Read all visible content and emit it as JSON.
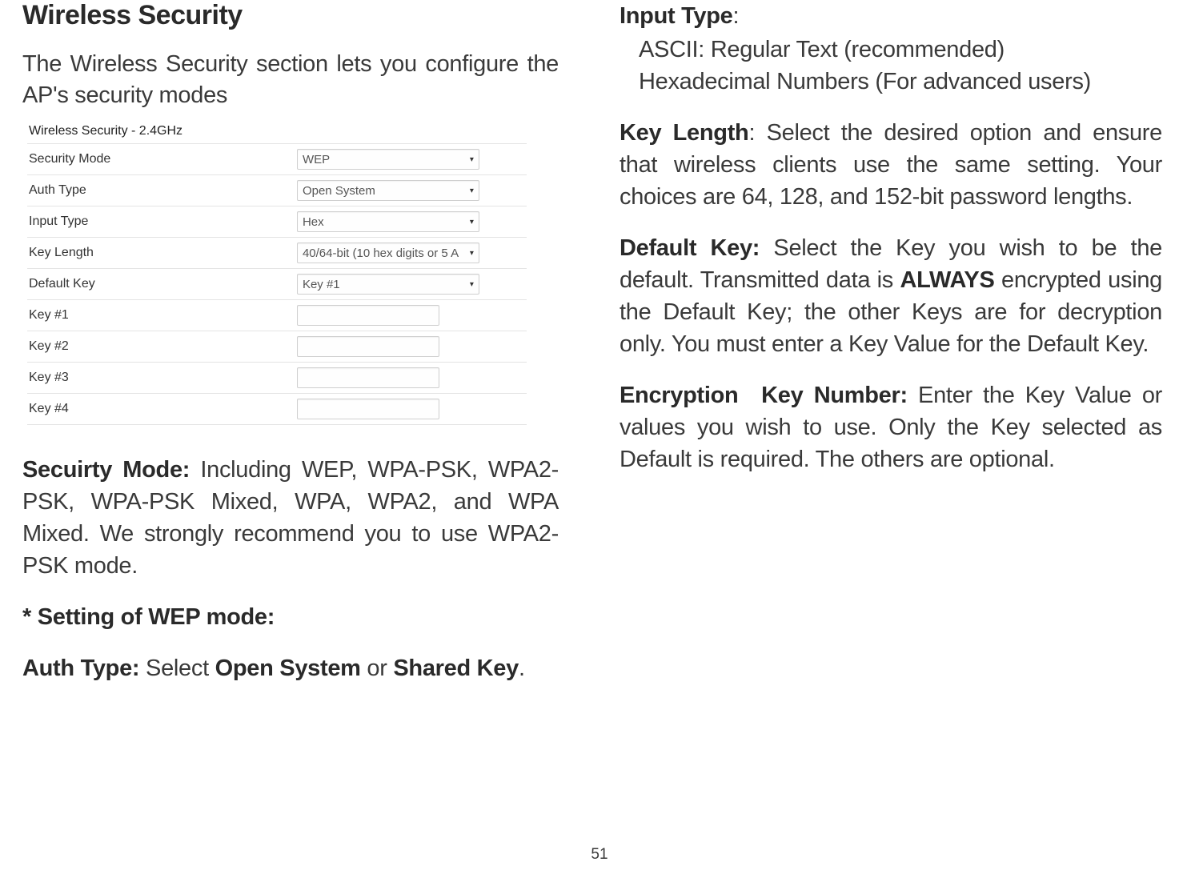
{
  "left": {
    "heading": "Wireless Security",
    "intro": "The Wireless Security section lets you configure the AP's security modes",
    "screenshot": {
      "title": "Wireless Security - 2.4GHz",
      "rows": [
        {
          "label": "Security Mode",
          "type": "select",
          "value": "WEP"
        },
        {
          "label": "Auth Type",
          "type": "select",
          "value": "Open System"
        },
        {
          "label": "Input Type",
          "type": "select",
          "value": "Hex"
        },
        {
          "label": "Key Length",
          "type": "select",
          "value": "40/64-bit (10 hex digits or 5 A"
        },
        {
          "label": "Default Key",
          "type": "select",
          "value": "Key #1"
        },
        {
          "label": "Key #1",
          "type": "input",
          "value": ""
        },
        {
          "label": "Key #2",
          "type": "input",
          "value": ""
        },
        {
          "label": "Key #3",
          "type": "input",
          "value": ""
        },
        {
          "label": "Key #4",
          "type": "input",
          "value": ""
        }
      ]
    },
    "security_mode_label": "Secuirty Mode:",
    "security_mode_text": " Including WEP, WPA-PSK, WPA2-PSK, WPA-PSK Mixed, WPA, WPA2, and WPA Mixed. We strongly recommend you to use WPA2-PSK mode.",
    "wep_heading": "* Setting of WEP mode:",
    "auth_type_label": "Auth Type:",
    "auth_type_mid": " Select ",
    "auth_type_opt1": "Open System",
    "auth_type_or": " or ",
    "auth_type_opt2": "Shared Key",
    "auth_type_end": "."
  },
  "right": {
    "input_type_label": "Input Type",
    "input_type_colon": ":",
    "input_type_line1": "ASCII: Regular Text (recommended)",
    "input_type_line2": "Hexadecimal Numbers (For advanced users)",
    "key_length_label": "Key Length",
    "key_length_text": ": Select the desired option and ensure that wireless clients use the same setting. Your choices are 64, 128, and 152-bit password lengths.",
    "default_key_label": "Default Key:",
    "default_key_p1": " Select the Key you wish to be the default. Transmitted data is ",
    "default_key_always": "ALWAYS",
    "default_key_p2": " encrypted using the Default Key; the other Keys are for decryption only. You must enter a Key Value for the Default Key.",
    "encryption_label": "Encryption Key Number:",
    "encryption_text": " Enter the Key Value or values you wish to use. Only the Key selected as Default is required. The others are optional."
  },
  "pagenum": "51"
}
